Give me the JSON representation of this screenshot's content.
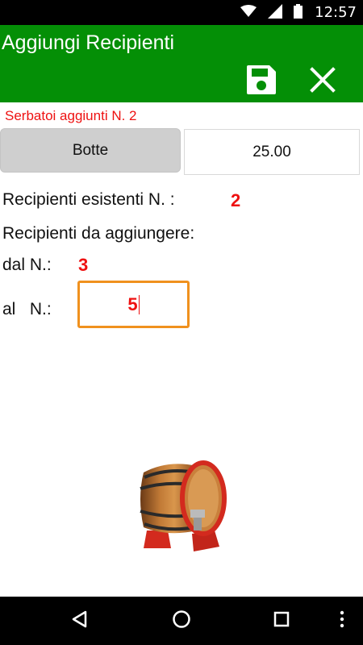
{
  "status_bar": {
    "time": "12:57",
    "icons": [
      "wifi-icon",
      "signal-icon",
      "battery-icon"
    ]
  },
  "app_bar": {
    "title": "Aggiungi Recipienti",
    "actions": [
      "save-icon",
      "close-icon"
    ]
  },
  "notice": "Serbatoi aggiunti N. 2",
  "container_type": {
    "label": "Botte"
  },
  "capacity": {
    "value": "25.00"
  },
  "existing": {
    "label": "Recipienti esistenti N. :",
    "value": "2"
  },
  "to_add": {
    "label": "Recipienti da aggiungere:"
  },
  "from": {
    "label": "dal N.:",
    "value": "3"
  },
  "to": {
    "label": "al   N.:",
    "value": "5"
  },
  "colors": {
    "appbar": "#048f06",
    "accent_red": "#ee1111",
    "input_focus": "#f0911e"
  },
  "nav_bar": {
    "buttons": [
      "back-icon",
      "home-icon",
      "recents-icon",
      "more-vert-icon"
    ]
  }
}
